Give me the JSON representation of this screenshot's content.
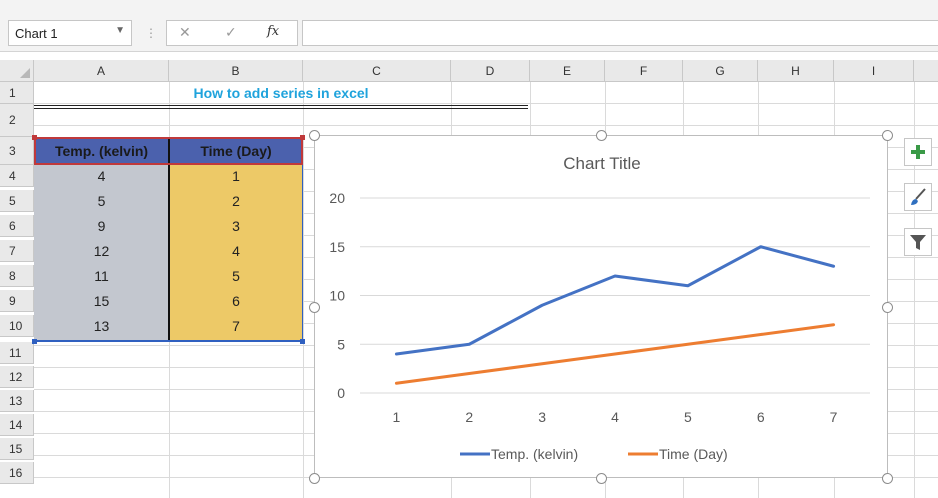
{
  "formula_bar": {
    "name_box": "Chart 1",
    "fx_label": "fx",
    "formula_value": ""
  },
  "columns": [
    "A",
    "B",
    "C",
    "D",
    "E",
    "F",
    "G",
    "H",
    "I"
  ],
  "rows": [
    "1",
    "2",
    "3",
    "4",
    "5",
    "6",
    "7",
    "8",
    "9",
    "10",
    "11",
    "12",
    "13",
    "14",
    "15",
    "16"
  ],
  "sheet": {
    "title": "How to add series in excel",
    "table": {
      "headers": [
        "Temp. (kelvin)",
        "Time (Day)"
      ],
      "rows": [
        [
          "4",
          "1"
        ],
        [
          "5",
          "2"
        ],
        [
          "9",
          "3"
        ],
        [
          "12",
          "4"
        ],
        [
          "11",
          "5"
        ],
        [
          "15",
          "6"
        ],
        [
          "13",
          "7"
        ]
      ]
    }
  },
  "chart_data": {
    "type": "line",
    "title": "Chart Title",
    "xlabel": "",
    "ylabel": "",
    "x": [
      "1",
      "2",
      "3",
      "4",
      "5",
      "6",
      "7"
    ],
    "ylim": [
      0,
      20
    ],
    "yticks": [
      "0",
      "5",
      "10",
      "15",
      "20"
    ],
    "grid": true,
    "legend": "bottom",
    "series": [
      {
        "name": "Temp. (kelvin)",
        "values": [
          4,
          5,
          9,
          12,
          11,
          15,
          13
        ],
        "color": "#4472c4"
      },
      {
        "name": "Time (Day)",
        "values": [
          1,
          2,
          3,
          4,
          5,
          6,
          7
        ],
        "color": "#ed7d31"
      }
    ]
  },
  "chart_tools": {
    "add_element_icon": "plus-icon",
    "style_icon": "brush-icon",
    "filter_icon": "filter-icon"
  },
  "colors": {
    "header_fill": "#4b61ad",
    "col_a_fill": "#c3c7cf",
    "col_b_fill": "#edc967",
    "title_color": "#1fa3dc"
  }
}
